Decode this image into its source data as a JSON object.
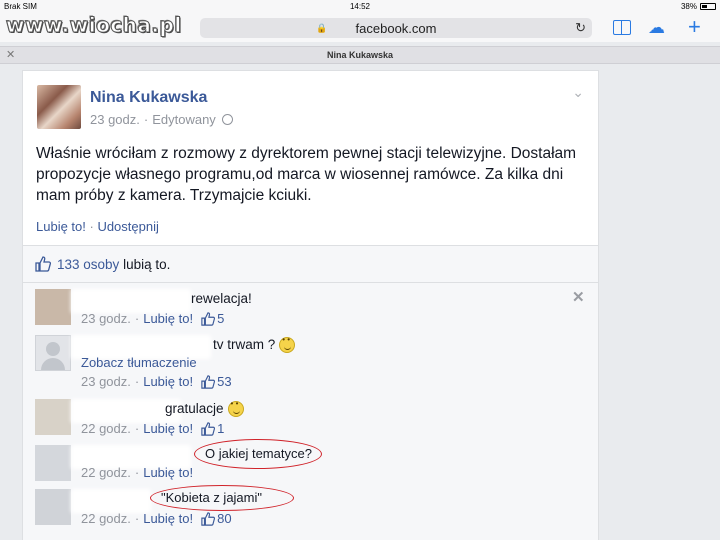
{
  "status_bar": {
    "carrier": "Brak SIM",
    "time": "14:52",
    "battery": "38%"
  },
  "browser": {
    "watermark": "www.wiocha.pl",
    "url": "facebook.com",
    "tab_title": "Nina Kukawska",
    "icons": {
      "lock": "lock-icon",
      "reload": "reload-icon",
      "bookmarks": "book-icon",
      "cloud": "cloud-icon",
      "new_tab": "plus-icon",
      "close_tab": "close-icon"
    }
  },
  "post": {
    "author": "Nina Kukawska",
    "time": "23 godz.",
    "dot": "·",
    "edited": "Edytowany",
    "text": "Właśnie wróciłam z rozmowy z dyrektorem pewnej stacji telewizyjne. Dostałam propozycje własnego programu,od marca w wiosennej ramówce. Za kilka dni mam próby z kamera. Trzymajcie kciuki.",
    "actions": {
      "like": "Lubię to!",
      "sep": " · ",
      "share": "Udostępnij"
    }
  },
  "likes": {
    "count_link": "133 osoby",
    "suffix": " lubią to."
  },
  "comments": [
    {
      "text": "rewelacja!",
      "time": "23 godz.",
      "like_label": "Lubię to!",
      "likes": "5"
    },
    {
      "text": "tv trwam ?",
      "translate": "Zobacz tłumaczenie",
      "time": "23 godz.",
      "like_label": "Lubię to!",
      "likes": "53"
    },
    {
      "text": "gratulacje",
      "time": "22 godz.",
      "like_label": "Lubię to!",
      "likes": "1"
    },
    {
      "text": "O jakiej tematyce?",
      "time": "22 godz.",
      "like_label": "Lubię to!"
    },
    {
      "text": "\"Kobieta z jajami\"",
      "time": "22 godz.",
      "like_label": "Lubię to!",
      "likes": "80"
    }
  ],
  "colors": {
    "fb_blue": "#3b5998",
    "gray_text": "#90949c",
    "annotation_red": "#d0232a",
    "ios_blue": "#2a7ae2"
  }
}
